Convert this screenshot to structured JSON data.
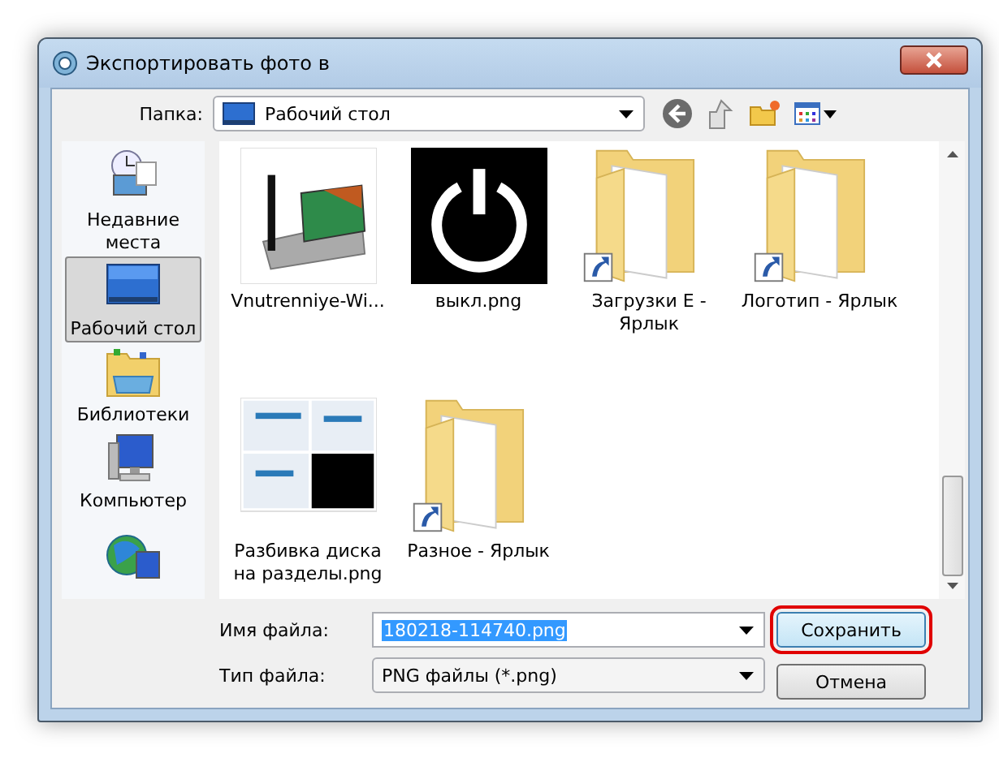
{
  "window": {
    "title": "Экспортировать фото в"
  },
  "folder_bar": {
    "label": "Папка:",
    "value": "Рабочий стол"
  },
  "sidebar": {
    "items": [
      {
        "label": "Недавние места",
        "kind": "recent",
        "selected": false
      },
      {
        "label": "Рабочий стол",
        "kind": "desktop",
        "selected": true
      },
      {
        "label": "Библиотеки",
        "kind": "libraries",
        "selected": false
      },
      {
        "label": "Компьютер",
        "kind": "computer",
        "selected": false
      },
      {
        "kind": "network",
        "selected": false
      }
    ]
  },
  "files": [
    {
      "name": "Vnutrenniye-Wi...",
      "kind": "wifi-card"
    },
    {
      "name": "выкл.png",
      "kind": "power-image"
    },
    {
      "name": "Загрузки E - Ярлык",
      "kind": "folder-shortcut"
    },
    {
      "name": "Логотип - Ярлык",
      "kind": "folder-shortcut"
    },
    {
      "name": "Разбивка диска на разделы.png",
      "kind": "screenshot-image"
    },
    {
      "name": "Разное - Ярлык",
      "kind": "folder-shortcut"
    }
  ],
  "file_name": {
    "label": "Имя файла:",
    "value": "180218-114740.png",
    "text_selected": true
  },
  "file_type": {
    "label": "Тип файла:",
    "value": "PNG файлы (*.png)"
  },
  "buttons": [
    {
      "label": "Сохранить",
      "highlighted": true
    },
    {
      "label": "Отмена",
      "highlighted": false
    }
  ]
}
